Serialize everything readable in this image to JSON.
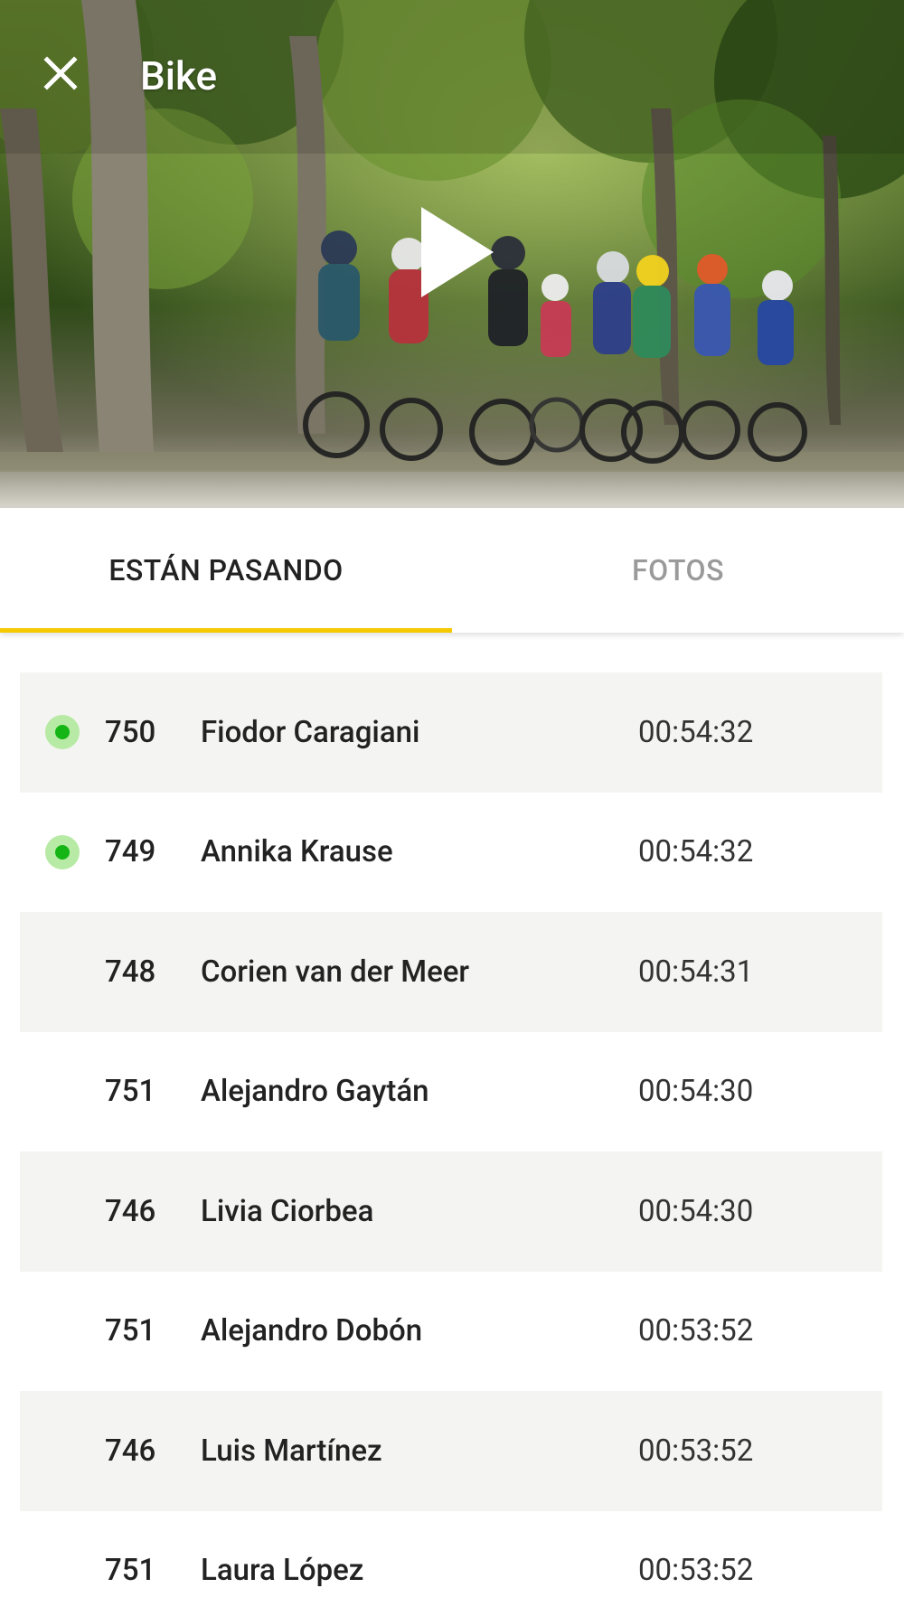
{
  "header": {
    "title": "Bike",
    "close_icon": "close-icon",
    "play_icon": "play-icon"
  },
  "tabs": [
    {
      "label": "ESTÁN PASANDO",
      "active": true
    },
    {
      "label": "FOTOS",
      "active": false
    }
  ],
  "colors": {
    "accent": "#f6c800",
    "row_alt": "#f4f4f2",
    "status_ring": "#b7eaa4",
    "status_dot": "#15b515"
  },
  "athletes": [
    {
      "bib": "750",
      "name": "Fiodor Caragiani",
      "time": "00:54:32",
      "live": true
    },
    {
      "bib": "749",
      "name": "Annika Krause",
      "time": "00:54:32",
      "live": true
    },
    {
      "bib": "748",
      "name": "Corien van der Meer",
      "time": "00:54:31",
      "live": false
    },
    {
      "bib": "751",
      "name": "Alejandro Gaytán",
      "time": "00:54:30",
      "live": false
    },
    {
      "bib": "746",
      "name": "Livia Ciorbea",
      "time": "00:54:30",
      "live": false
    },
    {
      "bib": "751",
      "name": "Alejandro Dobón",
      "time": "00:53:52",
      "live": false
    },
    {
      "bib": "746",
      "name": "Luis Martínez",
      "time": "00:53:52",
      "live": false
    },
    {
      "bib": "751",
      "name": "Laura López",
      "time": "00:53:52",
      "live": false
    }
  ]
}
